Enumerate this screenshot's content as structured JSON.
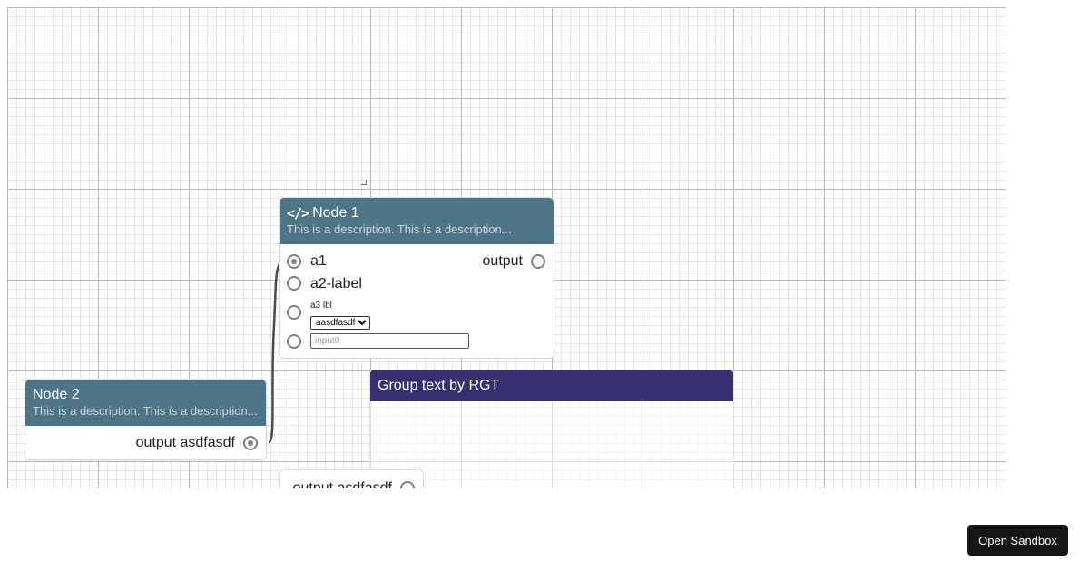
{
  "node1": {
    "icon": "code-icon",
    "title": "Node 1",
    "description": "This is a description. This is a description...",
    "inputs": [
      "a1",
      "a2-label"
    ],
    "a3_label": "a3 lbl",
    "a3_select_value": "aasdfasdf",
    "input0_placeholder": "input0",
    "output_label": "output"
  },
  "node2": {
    "title": "Node 2",
    "description": "This is a description. This is a description...",
    "output_label": "output asdfasdf"
  },
  "node3": {
    "output_label": "output asdfasdf"
  },
  "group": {
    "title": "Group text by RGT"
  },
  "sandbox_button": "Open Sandbox",
  "colors": {
    "node_header": "#4d7585",
    "group_header": "#373070",
    "port": "#808080",
    "button_bg": "#151515"
  }
}
